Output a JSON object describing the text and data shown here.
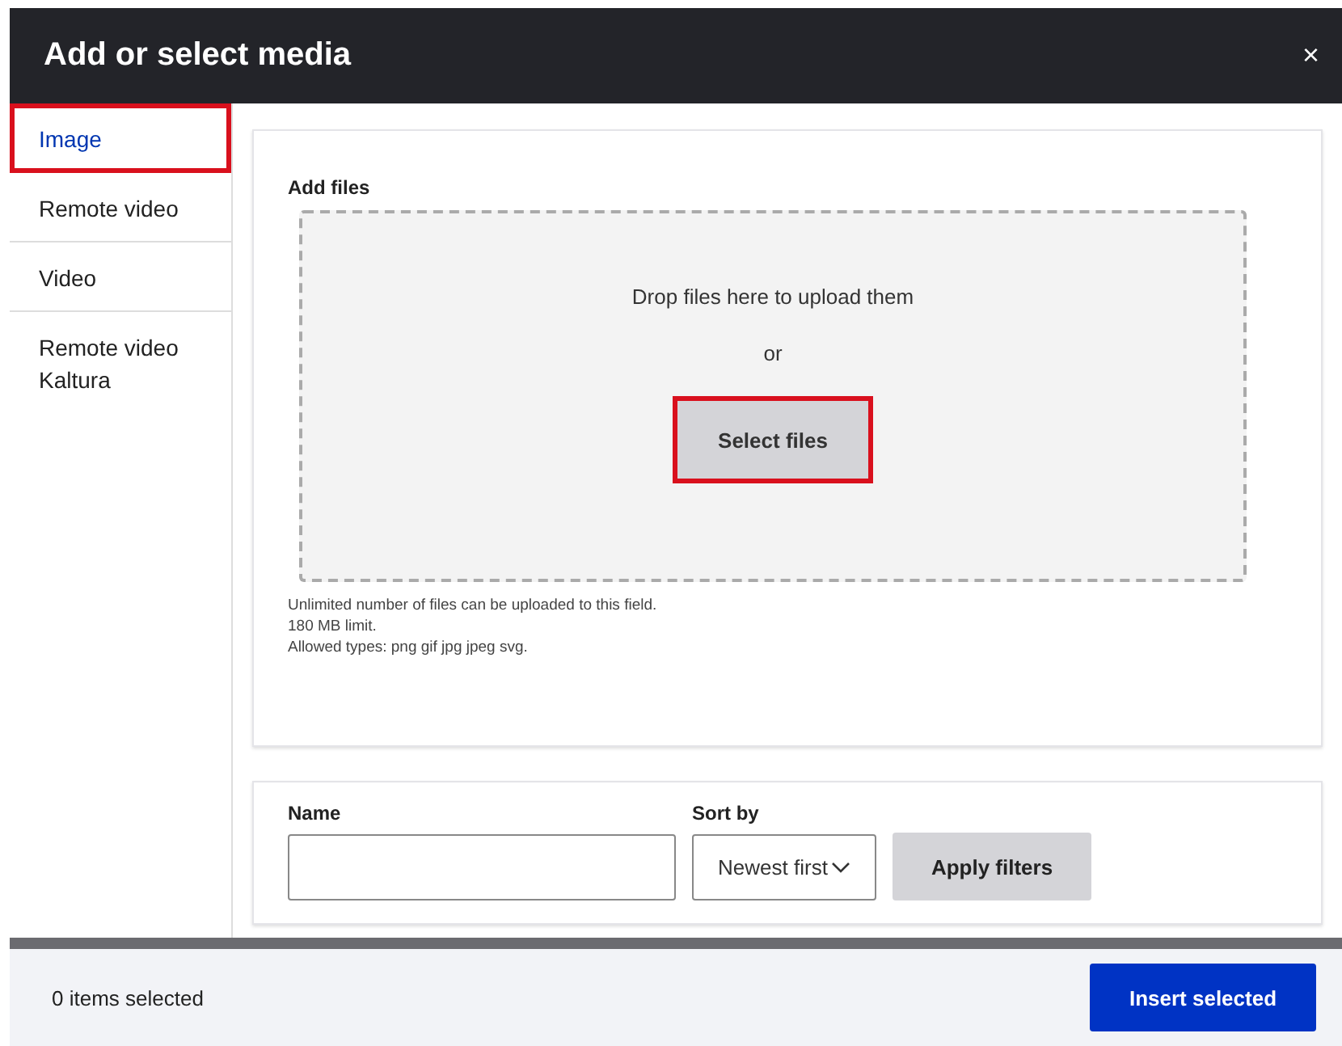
{
  "window": {
    "title": "Add or select media",
    "close": "×"
  },
  "tabs": [
    {
      "label": "Image",
      "selected": true,
      "highlighted": true
    },
    {
      "label": "Remote video",
      "selected": false,
      "highlighted": false
    },
    {
      "label": "Video",
      "selected": false,
      "highlighted": false
    },
    {
      "label": "Remote video Kaltura",
      "selected": false,
      "highlighted": false
    }
  ],
  "upload": {
    "label": "Add files",
    "drop_text": "Drop files here to upload them",
    "or": "or",
    "button": {
      "label": "Select files",
      "highlighted": true
    },
    "help": [
      "Unlimited number of files can be uploaded to this field.",
      "180 MB limit.",
      "Allowed types: png gif jpg jpeg svg."
    ]
  },
  "filters": {
    "name_label": "Name",
    "sort_label": "Sort by",
    "sort_value": "Newest first",
    "apply": "Apply filters"
  },
  "footer": {
    "count": "0 items selected",
    "insert": "Insert selected"
  }
}
